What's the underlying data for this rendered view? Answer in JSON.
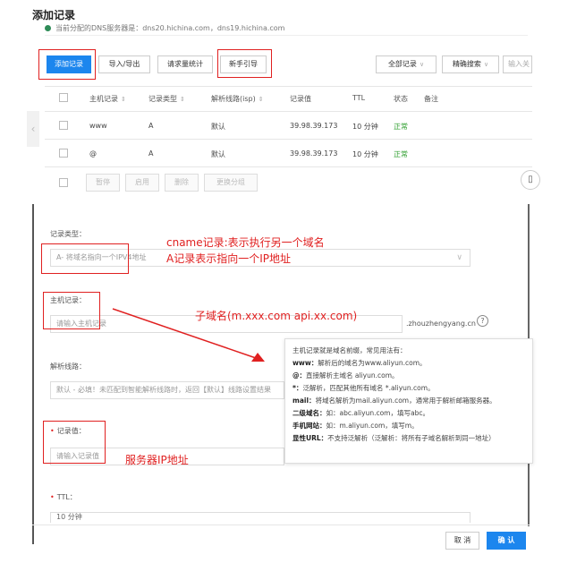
{
  "page": {
    "title": "添加记录"
  },
  "notice": {
    "text": "当前分配的DNS服务器是：dns20.hichina.com，dns19.hichina.com"
  },
  "toolbar": {
    "add_record": "添加记录",
    "import_export": "导入/导出",
    "request_stats": "请求量统计",
    "beginner_guide": "新手引导",
    "all_records": "全部记录",
    "precise_search": "精确搜索",
    "search_placeholder": "输入关"
  },
  "table": {
    "headers": [
      "主机记录",
      "记录类型",
      "解析线路(isp)",
      "记录值",
      "TTL",
      "状态",
      "备注"
    ],
    "rows": [
      {
        "host": "www",
        "type": "A",
        "line": "默认",
        "value": "39.98.39.173",
        "ttl": "10 分钟",
        "status": "正常"
      },
      {
        "host": "@",
        "type": "A",
        "line": "默认",
        "value": "39.98.39.173",
        "ttl": "10 分钟",
        "status": "正常"
      }
    ],
    "batch": [
      "暂停",
      "启用",
      "删除",
      "更换分组"
    ]
  },
  "form": {
    "record_type_label": "记录类型：",
    "record_type_value": "A- 将域名指向一个IPV4地址",
    "host_label": "主机记录：",
    "host_placeholder": "请输入主机记录",
    "host_suffix": ".zhouzhengyang.cn",
    "line_label": "解析线路：",
    "line_value": "默认 - 必填！未匹配到智能解析线路时，返回【默认】线路设置结果",
    "value_label": "记录值：",
    "value_placeholder": "请输入记录值",
    "ttl_label": "TTL：",
    "ttl_value": "10 分钟",
    "cancel": "取 消",
    "confirm": "确 认"
  },
  "annotations": {
    "cname": "cname记录:表示执行另一个域名",
    "a_record": "A记录表示指向一个IP地址",
    "subdomain": "子域名(m.xxx.com   api.xx.com)",
    "server_ip": "服务器IP地址"
  },
  "tooltip": {
    "intro": "主机记录就是域名前缀，常见用法有：",
    "www_key": "www：",
    "www_val": "解析后的域名为www.aliyun.com。",
    "at_key": "@：",
    "at_val": "直接解析主域名 aliyun.com。",
    "star_key": "*：",
    "star_val": "泛解析，匹配其他所有域名 *.aliyun.com。",
    "mail_key": "mail：",
    "mail_val": "将域名解析为mail.aliyun.com，通常用于解析邮箱服务器。",
    "second_key": "二级域名：",
    "second_val": "如：abc.aliyun.com，填写abc。",
    "mobile_key": "手机网站：",
    "mobile_val": "如：m.aliyun.com，填写m。",
    "url_key": "显性URL：",
    "url_val": "不支持泛解析（泛解析：将所有子域名解析到同一地址）"
  },
  "colors": {
    "accent": "#1c86ee",
    "annotation": "#e02020",
    "ok": "#2e9e2e"
  }
}
